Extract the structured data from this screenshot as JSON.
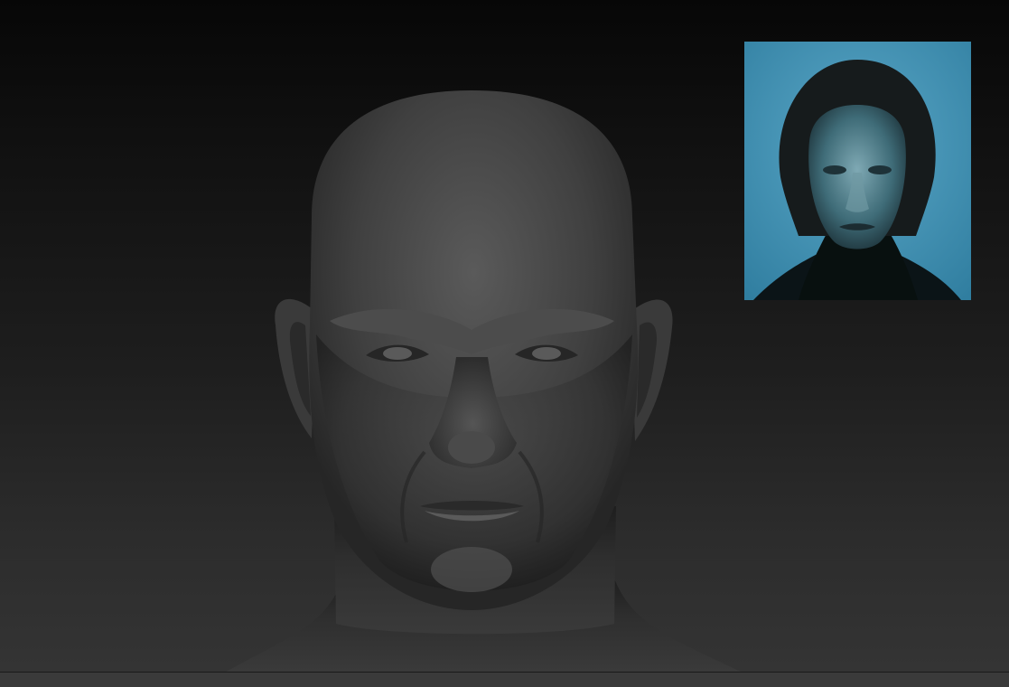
{
  "scene": {
    "background_top_color": "#070707",
    "background_bottom_color": "#343434",
    "model_color": "#3c3c3c",
    "bottom_bar_color": "#3a3a3a"
  },
  "viewport": {
    "subject": "sculpted-head-model"
  },
  "reference_image": {
    "subject": "portrait-photo",
    "background_color": "#3f8fae"
  }
}
